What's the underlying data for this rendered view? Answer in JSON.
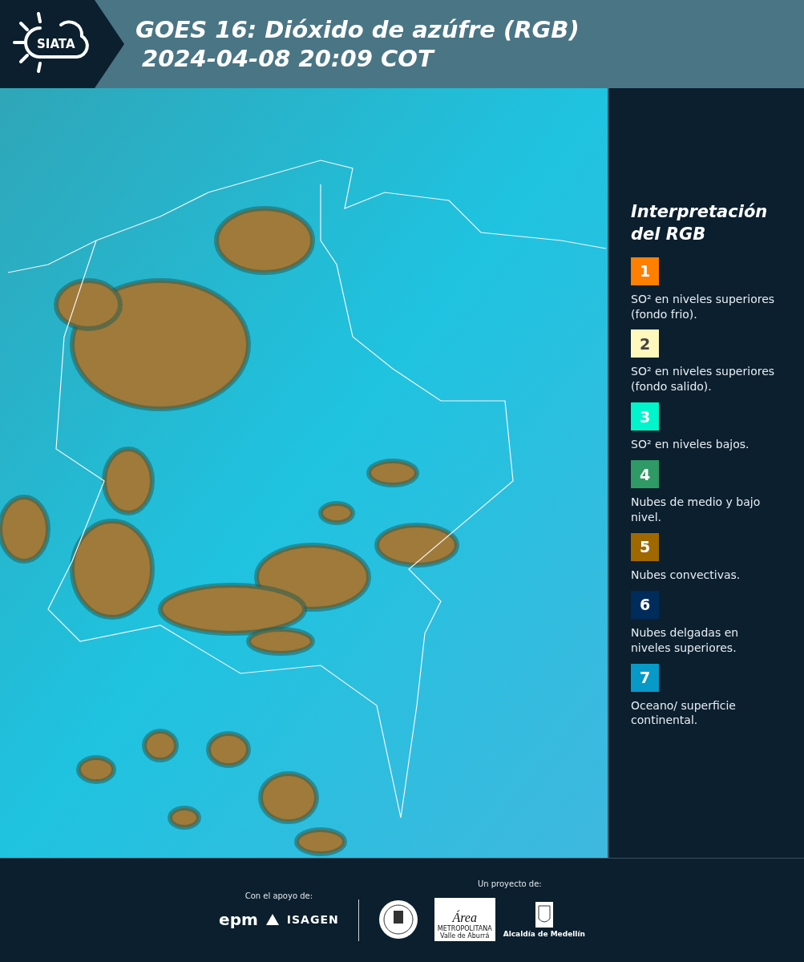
{
  "header": {
    "logo_text": "SIATA",
    "title": "GOES 16: Dióxido de azúfre (RGB)",
    "subtitle": "2024-04-08 20:09 COT"
  },
  "legend": {
    "title": "Interpretación del RGB",
    "items": [
      {
        "number": "1",
        "color": "#ff7f00",
        "text": "SO² en niveles superiores (fondo frio)."
      },
      {
        "number": "2",
        "color": "#fff8bd",
        "text": "SO² en niveles superiores (fondo salido)."
      },
      {
        "number": "3",
        "color": "#00f5cc",
        "text": "SO² en niveles bajos."
      },
      {
        "number": "4",
        "color": "#2f9a66",
        "text": "Nubes de medio y bajo nivel."
      },
      {
        "number": "5",
        "color": "#a06800",
        "text": "Nubes convectivas."
      },
      {
        "number": "6",
        "color": "#002c5c",
        "text": "Nubes delgadas en niveles superiores."
      },
      {
        "number": "7",
        "color": "#0799c8",
        "text": "Oceano/ superficie continental."
      }
    ]
  },
  "footer": {
    "support_label": "Con el apoyo de:",
    "support_logos": [
      "epm",
      "ISAGEN"
    ],
    "project_label": "Un proyecto de:",
    "area_logo": {
      "name": "Área",
      "line1": "METROPOLITANA",
      "line2": "Valle de Aburrá"
    },
    "city_logo": "Alcaldía de Medellín"
  }
}
